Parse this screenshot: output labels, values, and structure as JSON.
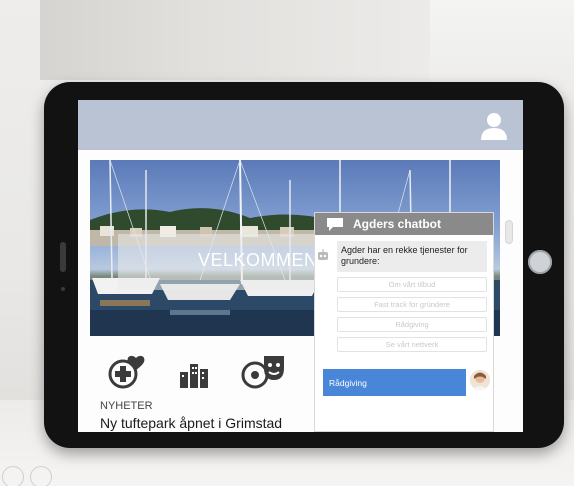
{
  "hero": {
    "welcome_text": "VELKOMMEN T"
  },
  "icons": [
    {
      "name": "health-plus-heart-icon",
      "color": "#3b3b3b"
    },
    {
      "name": "city-buildings-icon",
      "color": "#3b3b3b"
    },
    {
      "name": "culture-sports-icon",
      "color": "#3b3b3b"
    }
  ],
  "news": {
    "section_label": "NYHETER",
    "headline": "Ny tuftepark åpnet i Grimstad"
  },
  "chatbot": {
    "title": "Agders chatbot",
    "bot_message": "Agder har en rekke tjenester for grundere:",
    "options": [
      "Om vårt tilbud",
      "Fast track for gründere",
      "Rådgiving",
      "Se vårt nettverk"
    ],
    "user_reply": "Rådgiving"
  },
  "colors": {
    "app_bar": "#b9c3d4",
    "chat_header": "#8a8a8a",
    "user_reply": "#4a86d8"
  }
}
